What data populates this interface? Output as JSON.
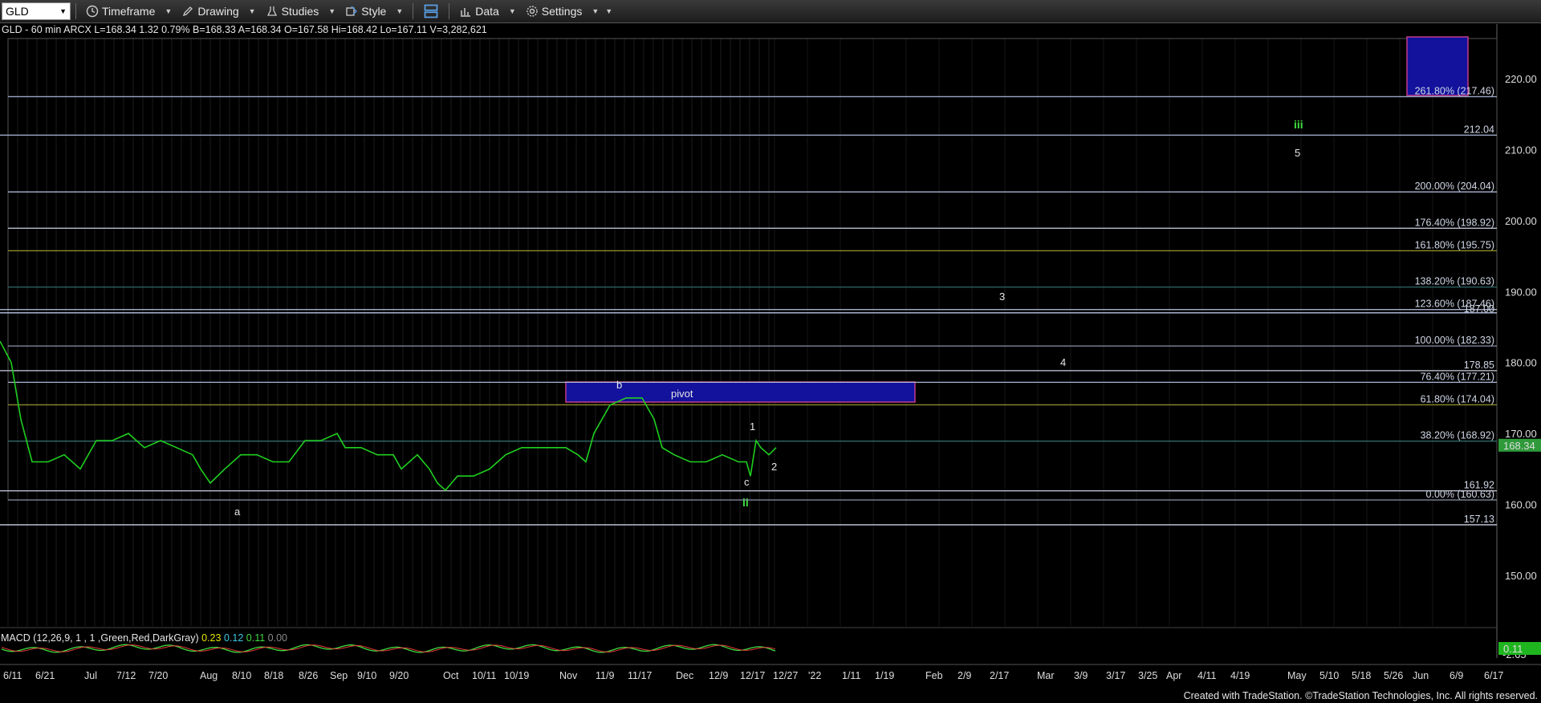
{
  "toolbar": {
    "symbol": "GLD",
    "timeframe_label": "Timeframe",
    "drawing_label": "Drawing",
    "studies_label": "Studies",
    "style_label": "Style",
    "data_label": "Data",
    "settings_label": "Settings"
  },
  "status_line": "GLD - 60 min  ARCX  L=168.34  1.32  0.79%  B=168.33  A=168.34  O=167.58  Hi=168.42  Lo=167.11  V=3,282,621",
  "price_axis": {
    "ticks": [
      "220.00",
      "210.00",
      "200.00",
      "190.00",
      "180.00",
      "170.00",
      "160.00",
      "150.00"
    ],
    "last_price": "168.34",
    "last_price_color": "#2e9a3a"
  },
  "levels": [
    {
      "price": 217.46,
      "label": "261.80% (217.46)",
      "color": "#9aa8c8"
    },
    {
      "price": 212.04,
      "label": "212.04",
      "color": "#a9b6d6"
    },
    {
      "price": 204.04,
      "label": "200.00% (204.04)",
      "color": "#b9c6e6"
    },
    {
      "price": 198.92,
      "label": "176.40% (198.92)",
      "color": "#c9d0e0"
    },
    {
      "price": 195.75,
      "label": "161.80% (195.75)",
      "color": "#8a8a2a"
    },
    {
      "price": 190.63,
      "label": "138.20% (190.63)",
      "color": "#2f6a6a"
    },
    {
      "price": 187.46,
      "label": "123.60% (187.46)",
      "color": "#b9c6e6"
    },
    {
      "price": 187.0,
      "label": "187.00",
      "color": "#b9c6e6"
    },
    {
      "price": 182.33,
      "label": "100.00% (182.33)",
      "color": "#8a94aa"
    },
    {
      "price": 178.85,
      "label": "178.85",
      "color": "#c9d0e0"
    },
    {
      "price": 177.21,
      "label": "76.40% (177.21)",
      "color": "#a9b6d6"
    },
    {
      "price": 174.04,
      "label": "61.80% (174.04)",
      "color": "#8a8a2a"
    },
    {
      "price": 168.92,
      "label": "38.20% (168.92)",
      "color": "#2f6a6a"
    },
    {
      "price": 161.92,
      "label": "161.92",
      "color": "#c9d0e0"
    },
    {
      "price": 160.63,
      "label": "0.00% (160.63)",
      "color": "#8a94aa"
    },
    {
      "price": 157.13,
      "label": "157.13",
      "color": "#c9d0e0"
    }
  ],
  "wave_labels": [
    {
      "text": "a",
      "style": "white"
    },
    {
      "text": "b",
      "style": "white"
    },
    {
      "text": "c",
      "style": "white"
    },
    {
      "text": "ii",
      "style": "green"
    },
    {
      "text": "1",
      "style": "white"
    },
    {
      "text": "2",
      "style": "white"
    },
    {
      "text": "3",
      "style": "white"
    },
    {
      "text": "4",
      "style": "white"
    },
    {
      "text": "5",
      "style": "white"
    },
    {
      "text": "iii",
      "style": "green"
    }
  ],
  "pivot_label": "pivot",
  "x_axis": [
    "6/11",
    "6/21",
    "Jul",
    "7/12",
    "7/20",
    "Aug",
    "8/10",
    "8/18",
    "8/26",
    "Sep",
    "9/10",
    "9/20",
    "Oct",
    "10/11",
    "10/19",
    "Nov",
    "11/9",
    "11/17",
    "Dec",
    "12/9",
    "12/17",
    "12/27",
    "'22",
    "1/11",
    "1/19",
    "Feb",
    "2/9",
    "2/17",
    "Mar",
    "3/9",
    "3/17",
    "3/25",
    "Apr",
    "4/11",
    "4/19",
    "May",
    "5/10",
    "5/18",
    "5/26",
    "Jun",
    "6/9",
    "6/17"
  ],
  "macd": {
    "name": "MACD (12,26,9, 1 , 1 ,Green,Red,DarkGray)",
    "v1": "0.23",
    "v2": "0.12",
    "v3": "0.11",
    "v4": "0.00",
    "axis_low": "-2.65",
    "last": "0.11"
  },
  "footer": "Created with TradeStation. ©TradeStation Technologies, Inc. All rights reserved."
}
